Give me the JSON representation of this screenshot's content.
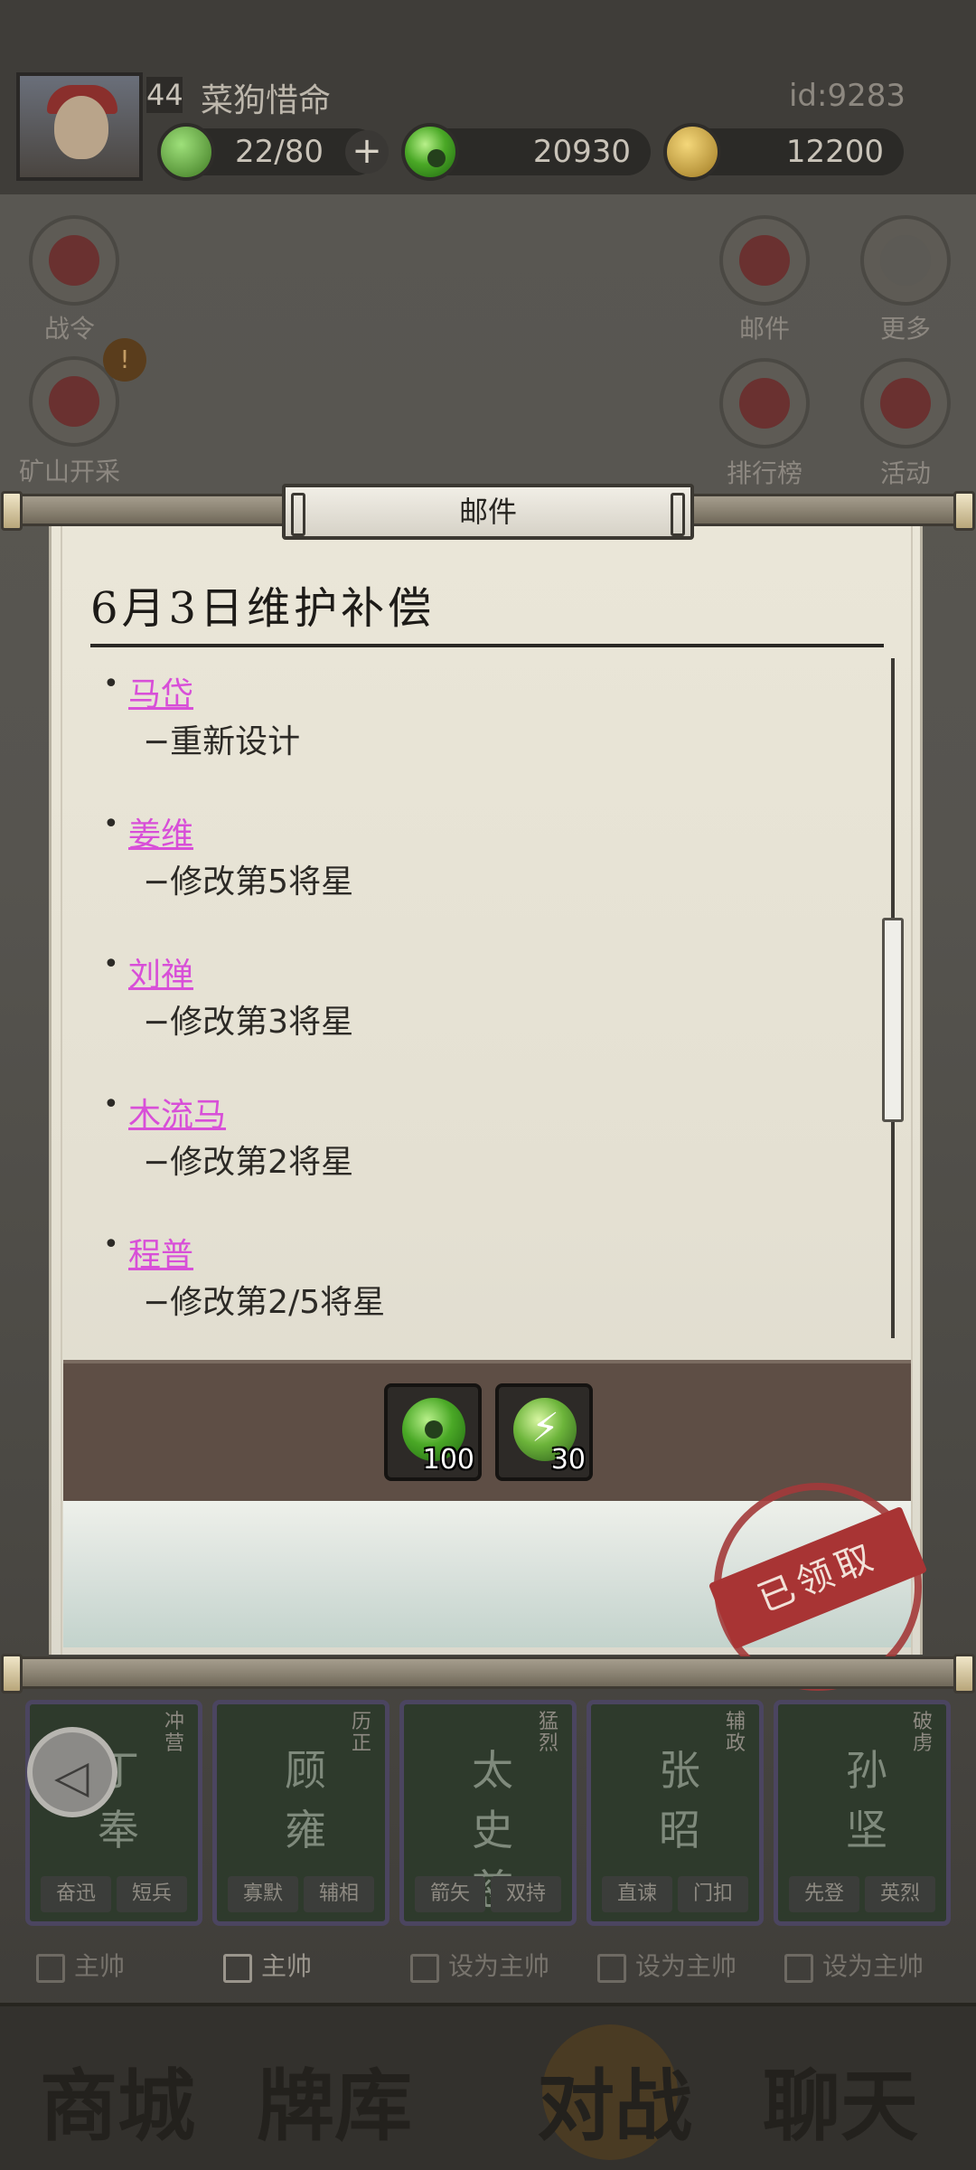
{
  "player": {
    "level": "44",
    "name": "菜狗惜命",
    "id_label": "id:9283",
    "energy": "22/80",
    "jade": "20930",
    "gold": "12200"
  },
  "side_buttons": {
    "battle_pass": "战令",
    "mining": "矿山开采",
    "mining_badge": "!",
    "mail": "邮件",
    "more": "更多",
    "ranking": "排行榜",
    "activity": "活动"
  },
  "modal": {
    "header": "邮件",
    "mail_title": "6月3日维护补偿",
    "entries": [
      {
        "name": "马岱",
        "note": "−重新设计"
      },
      {
        "name": "姜维",
        "note": "−修改第5将星"
      },
      {
        "name": "刘禅",
        "note": "−修改第3将星"
      },
      {
        "name": "木流马",
        "note": "−修改第2将星"
      },
      {
        "name": "程普",
        "note": "−修改第2/5将星"
      }
    ],
    "rewards": [
      {
        "icon": "jade-icon",
        "count": "100"
      },
      {
        "icon": "energy-icon",
        "count": "30"
      }
    ],
    "stamp": "已领取"
  },
  "cards": [
    {
      "name": "丁奉",
      "trait": "冲营",
      "skills": [
        "奋迅",
        "短兵"
      ]
    },
    {
      "name": "顾雍",
      "trait": "历正",
      "skills": [
        "寡默",
        "辅相"
      ]
    },
    {
      "name": "太史慈",
      "trait": "猛烈",
      "skills": [
        "箭矢",
        "双持"
      ]
    },
    {
      "name": "张昭",
      "trait": "辅政",
      "skills": [
        "直谏",
        "门扣"
      ]
    },
    {
      "name": "孙坚",
      "trait": "破虏",
      "skills": [
        "先登",
        "英烈"
      ]
    }
  ],
  "card_options": [
    "主帅",
    "主帅",
    "设为主帅",
    "设为主帅",
    "设为主帅"
  ],
  "nav": [
    "商城",
    "牌库",
    "对战",
    "聊天"
  ],
  "colors": {
    "link": "#d84fd8",
    "paper": "#e4e0d2",
    "stamp": "#a83434"
  }
}
